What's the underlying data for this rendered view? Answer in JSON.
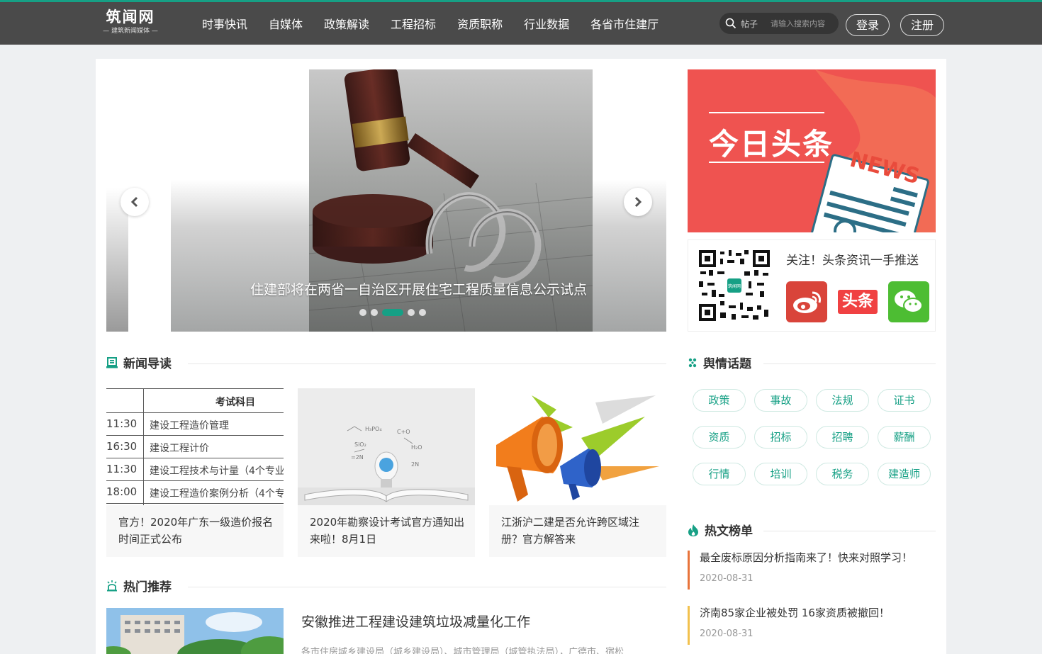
{
  "header": {
    "logo_name": "筑闻网",
    "logo_sub": "— 建筑新闻媒体 —",
    "nav": [
      "时事快讯",
      "自媒体",
      "政策解读",
      "工程招标",
      "资质职称",
      "行业数据",
      "各省市住建厅"
    ],
    "search_scope": "帖子",
    "search_placeholder": "请输入搜索内容",
    "login": "登录",
    "register": "注册"
  },
  "carousel": {
    "caption": "住建部将在两省一自治区开展住宅工程质量信息公示试点",
    "slide_count": 5,
    "active_slide": 3
  },
  "ad": {
    "title": "今日头条",
    "news_word": "NEWS",
    "follow_text": "关注！头条资讯一手推送",
    "qr_badge": "筑闻网",
    "toutiao_text": "头条"
  },
  "news_section": {
    "title": "新闻导读",
    "cards": [
      {
        "caption": "官方！2020年广东一级造价报名时间正式公布",
        "table_header": "考试科目",
        "table_rows": [
          {
            "time": "11:30",
            "subject": "建设工程造价管理"
          },
          {
            "time": "16:30",
            "subject": "建设工程计价"
          },
          {
            "time": "11:30",
            "subject": "建设工程技术与计量（4个专业"
          },
          {
            "time": "18:00",
            "subject": "建设工程造价案例分析（4个专"
          }
        ]
      },
      {
        "caption": "2020年勘察设计考试官方通知出来啦！8月1日"
      },
      {
        "caption": "江浙沪二建是否允许跨区域注册？官方解答来"
      }
    ]
  },
  "recommend": {
    "title": "热门推荐",
    "item_title": "安徽推进工程建设建筑垃圾减量化工作",
    "item_desc": "各市住房城乡建设局（城乡建设局）、城市管理局（城管执法局），广德市、宿松"
  },
  "topics": {
    "title": "舆情话题",
    "tags": [
      "政策",
      "事故",
      "法规",
      "证书",
      "资质",
      "招标",
      "招聘",
      "薪酬",
      "行情",
      "培训",
      "税务",
      "建造师"
    ]
  },
  "hot": {
    "title": "热文榜单",
    "items": [
      {
        "title": "最全废标原因分析指南来了！快来对照学习！",
        "date": "2020-08-31",
        "color": "#e8743b"
      },
      {
        "title": "济南85家企业被处罚 16家资质被撤回！",
        "date": "2020-08-31",
        "color": "#f2c14e"
      }
    ]
  },
  "colors": {
    "accent": "#16a085",
    "header_bg": "#4a4a4a",
    "ad_red": "#ef5350"
  }
}
